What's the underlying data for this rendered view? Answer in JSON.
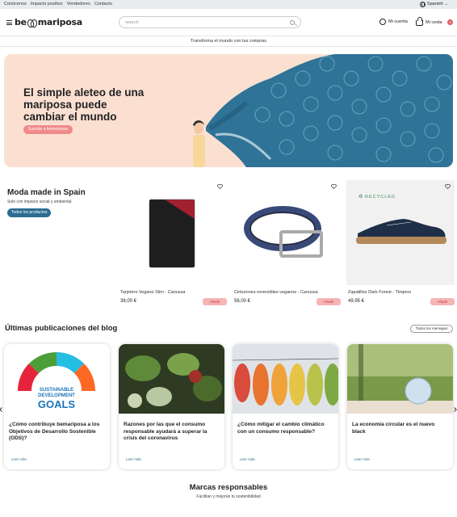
{
  "topbar": {
    "links": [
      "Conócenos",
      "Impacto positivo",
      "Vendedores",
      "Contacto"
    ],
    "language": "Spanish"
  },
  "header": {
    "logo_text_left": "be",
    "logo_text_right": "mariposa",
    "search_placeholder": "search",
    "account_label": "Mi cuenta",
    "cart_label": "Mi cesta",
    "cart_count": "0"
  },
  "tagline": "Transforma el mundo con tus compras",
  "hero": {
    "title": "El simple aleteo de una mariposa puede cambiar el mundo",
    "button": "Sumate a bemariposa"
  },
  "moda": {
    "title": "Moda made in Spain",
    "subtitle": "Solo con impacto social y ambiental",
    "button": "Todos los productos"
  },
  "products": [
    {
      "name": "Tarjetero Vegano Slim - Canussa",
      "price": "38,00 €",
      "add_label": "Añadir"
    },
    {
      "name": "Cinturones reversibles veganos - Canussa",
      "price": "56,00 €",
      "add_label": "Añadir"
    },
    {
      "name": "Zapatillos Dark Forest - Timpers",
      "price": "49,95 €",
      "add_label": "Añadir",
      "badge": "RECYCLED"
    }
  ],
  "blog": {
    "title": "Últimas publicaciones del blog",
    "all_button": "Todos los mensajes",
    "posts": [
      {
        "title": "¿Cómo contribuye bemariposa a los Objetivos de Desarrollo Sostenible (ODS)?",
        "more": "Leer más",
        "img_text": [
          "SUSTAINABLE",
          "DEVELOPMENT",
          "GOALS"
        ]
      },
      {
        "title": "Razones por las que el consumo responsable ayudará a superar la crisis del coronavirus",
        "more": "Leer más"
      },
      {
        "title": "¿Cómo mitigar el cambio climático con un consumo responsable?",
        "more": "Leer más"
      },
      {
        "title": "La economía circular es el nuevo black",
        "more": "Leer más"
      }
    ]
  },
  "brands": {
    "title": "Marcas responsables",
    "subtitle": "Facilitan y mejoran tu sostenibilidad"
  },
  "colors": {
    "hero_bg": "#fbe0d2",
    "hero_wave": "#2f7397",
    "accent_pink": "#f08a8a",
    "accent_blue": "#2d6d93",
    "topbar_bg": "#e9ecef"
  }
}
